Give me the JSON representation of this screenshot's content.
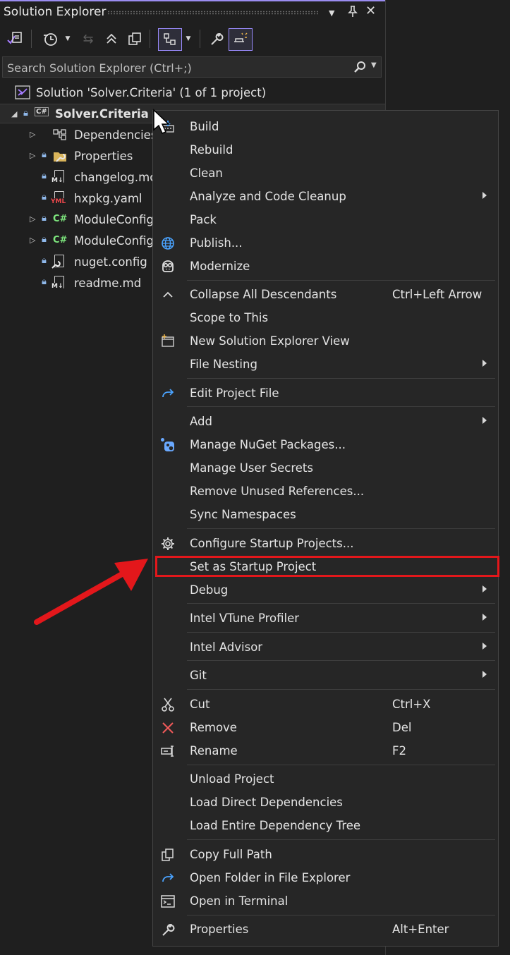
{
  "panel": {
    "title": "Solution Explorer",
    "search_placeholder": "Search Solution Explorer (Ctrl+;)"
  },
  "tree": {
    "solution_label": "Solution 'Solver.Criteria' (1 of 1 project)",
    "project": {
      "label": "Solver.Criteria",
      "tag": "C#"
    },
    "items": [
      {
        "label": "Dependencies",
        "icon": "dependencies-icon"
      },
      {
        "label": "Properties",
        "icon": "properties-folder-icon"
      },
      {
        "label": "changelog.mc",
        "icon": "markdown-file-icon",
        "tag": "M↓"
      },
      {
        "label": "hxpkg.yaml",
        "icon": "yaml-file-icon",
        "tag": "YML"
      },
      {
        "label": "ModuleConfig",
        "icon": "csharp-file-icon",
        "tag": "C#"
      },
      {
        "label": "ModuleConfig",
        "icon": "csharp-file-icon",
        "tag": "C#"
      },
      {
        "label": "nuget.config",
        "icon": "config-file-icon"
      },
      {
        "label": "readme.md",
        "icon": "markdown-file-icon",
        "tag": "M↓"
      }
    ]
  },
  "context_menu": {
    "items": [
      {
        "label": "Build",
        "icon": "build-icon"
      },
      {
        "label": "Rebuild"
      },
      {
        "label": "Clean"
      },
      {
        "label": "Analyze and Code Cleanup",
        "submenu": true
      },
      {
        "label": "Pack"
      },
      {
        "label": "Publish...",
        "icon": "globe-icon"
      },
      {
        "label": "Modernize",
        "icon": "copilot-icon"
      },
      {
        "label": "Collapse All Descendants",
        "shortcut": "Ctrl+Left Arrow",
        "icon": "chevron-up-icon"
      },
      {
        "label": "Scope to This"
      },
      {
        "label": "New Solution Explorer View",
        "icon": "new-window-icon"
      },
      {
        "label": "File Nesting",
        "submenu": true
      },
      {
        "label": "Edit Project File",
        "icon": "edit-arrow-icon"
      },
      {
        "label": "Add",
        "submenu": true
      },
      {
        "label": "Manage NuGet Packages...",
        "icon": "nuget-icon"
      },
      {
        "label": "Manage User Secrets"
      },
      {
        "label": "Remove Unused References..."
      },
      {
        "label": "Sync Namespaces"
      },
      {
        "label": "Configure Startup Projects...",
        "icon": "gear-icon"
      },
      {
        "label": "Set as Startup Project"
      },
      {
        "label": "Debug",
        "submenu": true
      },
      {
        "label": "Intel VTune Profiler",
        "submenu": true
      },
      {
        "label": "Intel Advisor",
        "submenu": true
      },
      {
        "label": "Git",
        "submenu": true
      },
      {
        "label": "Cut",
        "shortcut": "Ctrl+X",
        "icon": "scissors-icon"
      },
      {
        "label": "Remove",
        "shortcut": "Del",
        "icon": "remove-x-icon"
      },
      {
        "label": "Rename",
        "shortcut": "F2",
        "icon": "rename-icon"
      },
      {
        "label": "Unload Project"
      },
      {
        "label": "Load Direct Dependencies"
      },
      {
        "label": "Load Entire Dependency Tree"
      },
      {
        "label": "Copy Full Path",
        "icon": "copy-icon"
      },
      {
        "label": "Open Folder in File Explorer",
        "icon": "open-folder-arrow-icon"
      },
      {
        "label": "Open in Terminal",
        "icon": "terminal-icon"
      },
      {
        "label": "Properties",
        "shortcut": "Alt+Enter",
        "icon": "wrench-icon"
      }
    ]
  },
  "colors": {
    "background": "#1f1f1f",
    "menu_bg": "#262626",
    "accent": "#9a8cf0",
    "highlight_red": "#e3171b",
    "csharp_green": "#7ee87e",
    "lock_blue": "#8fb8ea"
  }
}
